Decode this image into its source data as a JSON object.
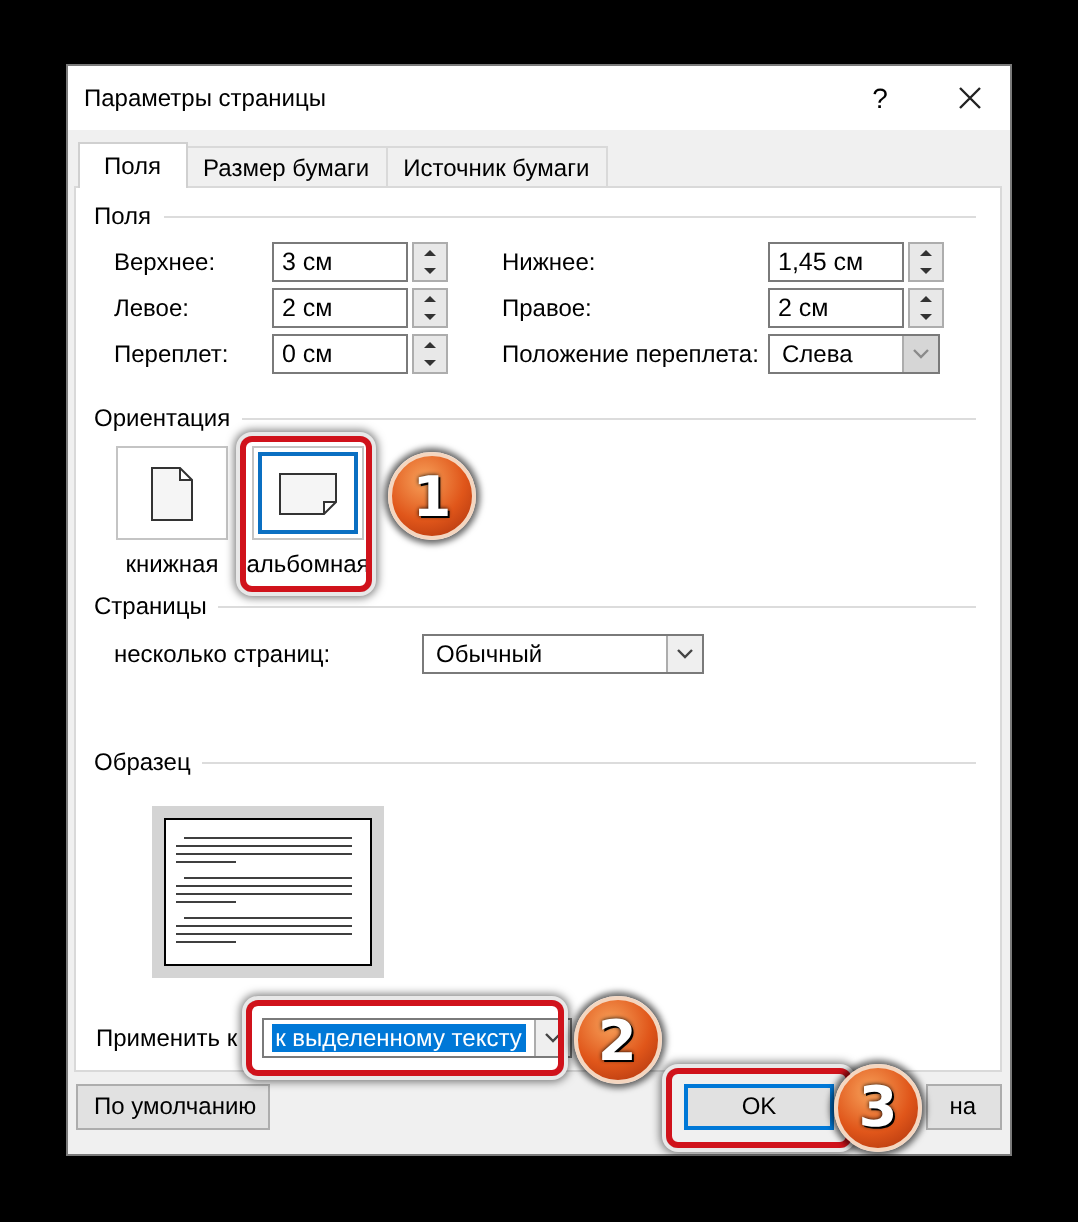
{
  "window": {
    "title": "Параметры страницы",
    "help": "?"
  },
  "tabs": [
    {
      "label": "Поля",
      "selected": true
    },
    {
      "label": "Размер бумаги",
      "selected": false
    },
    {
      "label": "Источник бумаги",
      "selected": false
    }
  ],
  "margins": {
    "title": "Поля",
    "fields": [
      {
        "label": "Верхнее:",
        "value": "3 см",
        "kind": "spin"
      },
      {
        "label": "Нижнее:",
        "value": "1,45 см",
        "kind": "spin"
      },
      {
        "label": "Левое:",
        "value": "2 см",
        "kind": "spin"
      },
      {
        "label": "Правое:",
        "value": "2 см",
        "kind": "spin"
      },
      {
        "label": "Переплет:",
        "value": "0 см",
        "kind": "spin"
      },
      {
        "label": "Положение переплета:",
        "value": "Слева",
        "kind": "combo",
        "disabled": true
      }
    ]
  },
  "orientation": {
    "title": "Ориентация",
    "options": [
      {
        "label": "книжная",
        "kind": "portrait",
        "selected": false
      },
      {
        "label": "альбомная",
        "kind": "landscape",
        "selected": true,
        "callout": "1"
      }
    ]
  },
  "pages": {
    "title": "Страницы",
    "label": "несколько страниц:",
    "value": "Обычный"
  },
  "preview": {
    "title": "Образец"
  },
  "apply": {
    "label": "Применить к",
    "value": "к выделенному тексту",
    "highlighted": true,
    "callout": "2"
  },
  "buttons": [
    {
      "label": "По умолчанию",
      "default": false
    },
    {
      "label": "OK",
      "default": true,
      "callout": "3"
    },
    {
      "label": "на",
      "default": false
    }
  ]
}
